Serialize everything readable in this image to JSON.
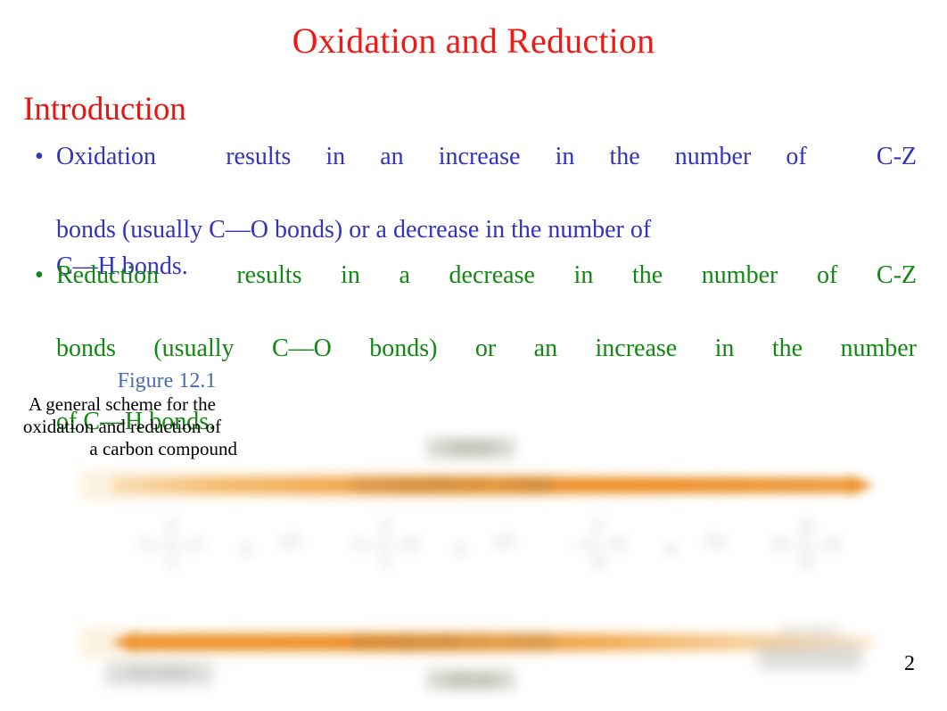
{
  "slide": {
    "title": "Oxidation and Reduction",
    "page_number": "2",
    "title_color": "#ef1a16",
    "heading_color": "#e8140f",
    "bullet1_color": "#3333bb",
    "bullet2_color": "#118811",
    "figure_label_color": "#4a6bb0",
    "arrow_color": "#ec922c"
  },
  "heading": {
    "text": "Introduction"
  },
  "bullets": [
    {
      "marker": "•",
      "lead_word": "Oxidation",
      "line1_tail": "results in an increase in the number of",
      "line1_end": "C-Z",
      "line2": "bonds (usually C—O bonds) or a decrease in the number of",
      "line3": "C—H bonds.",
      "full_text": "Oxidation results in an increase in the number of C-Z bonds (usually C—O bonds) or a decrease in the number of C—H bonds."
    },
    {
      "marker": "•",
      "lead_word": "Reduction",
      "line1_tail": "results in a decrease in the number of C-Z",
      "line2": "bonds (usually C—O bonds) or an increase in the number",
      "line3": "of C—H bonds.",
      "full_text": "Reduction results in a decrease in the number of C-Z bonds (usually C—O bonds) or an increase in the number of C—H bonds."
    }
  ],
  "figure": {
    "label": "Figure 12.1",
    "caption_line1": "A general scheme for the",
    "caption_line2": "oxidation and reduction of",
    "caption_line3": "a carbon compound",
    "top_arrow_caption": "increasing number of C—Z bonds",
    "bottom_arrow_caption": "decreasing number of C—Z bonds",
    "top_pill_label": "oxidation",
    "bottom_pill_label": "reduction",
    "structures": [
      {
        "up": "Z",
        "mid": "Z—C—Z",
        "dn": "Z"
      },
      {
        "up": "Z",
        "mid": "Z—C—H",
        "dn": "Z"
      },
      {
        "up": "Z",
        "mid": "—C—H",
        "dn": "H"
      },
      {
        "up": "H",
        "mid": "H—C—H",
        "dn": "H"
      }
    ],
    "plus_signs": [
      "+",
      "+",
      "+"
    ],
    "reagents": [
      "[O]",
      "[O]",
      "[O]"
    ],
    "note_left": "most oxidized",
    "note_right": "most reduced"
  }
}
